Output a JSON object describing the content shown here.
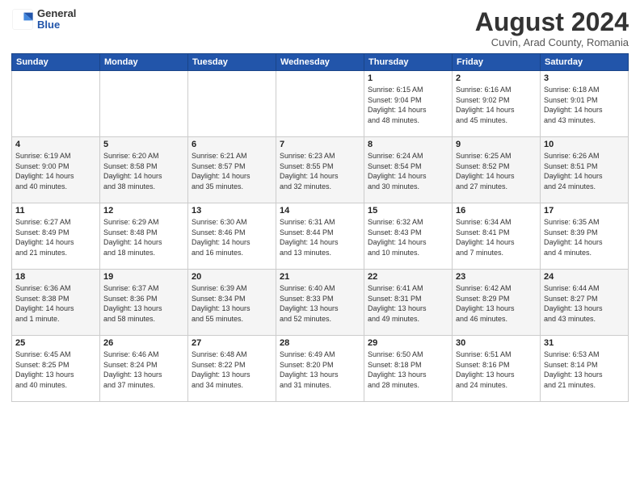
{
  "logo": {
    "general": "General",
    "blue": "Blue"
  },
  "header": {
    "title": "August 2024",
    "subtitle": "Cuvin, Arad County, Romania"
  },
  "days_of_week": [
    "Sunday",
    "Monday",
    "Tuesday",
    "Wednesday",
    "Thursday",
    "Friday",
    "Saturday"
  ],
  "weeks": [
    [
      {
        "day": "",
        "info": ""
      },
      {
        "day": "",
        "info": ""
      },
      {
        "day": "",
        "info": ""
      },
      {
        "day": "",
        "info": ""
      },
      {
        "day": "1",
        "info": "Sunrise: 6:15 AM\nSunset: 9:04 PM\nDaylight: 14 hours\nand 48 minutes."
      },
      {
        "day": "2",
        "info": "Sunrise: 6:16 AM\nSunset: 9:02 PM\nDaylight: 14 hours\nand 45 minutes."
      },
      {
        "day": "3",
        "info": "Sunrise: 6:18 AM\nSunset: 9:01 PM\nDaylight: 14 hours\nand 43 minutes."
      }
    ],
    [
      {
        "day": "4",
        "info": "Sunrise: 6:19 AM\nSunset: 9:00 PM\nDaylight: 14 hours\nand 40 minutes."
      },
      {
        "day": "5",
        "info": "Sunrise: 6:20 AM\nSunset: 8:58 PM\nDaylight: 14 hours\nand 38 minutes."
      },
      {
        "day": "6",
        "info": "Sunrise: 6:21 AM\nSunset: 8:57 PM\nDaylight: 14 hours\nand 35 minutes."
      },
      {
        "day": "7",
        "info": "Sunrise: 6:23 AM\nSunset: 8:55 PM\nDaylight: 14 hours\nand 32 minutes."
      },
      {
        "day": "8",
        "info": "Sunrise: 6:24 AM\nSunset: 8:54 PM\nDaylight: 14 hours\nand 30 minutes."
      },
      {
        "day": "9",
        "info": "Sunrise: 6:25 AM\nSunset: 8:52 PM\nDaylight: 14 hours\nand 27 minutes."
      },
      {
        "day": "10",
        "info": "Sunrise: 6:26 AM\nSunset: 8:51 PM\nDaylight: 14 hours\nand 24 minutes."
      }
    ],
    [
      {
        "day": "11",
        "info": "Sunrise: 6:27 AM\nSunset: 8:49 PM\nDaylight: 14 hours\nand 21 minutes."
      },
      {
        "day": "12",
        "info": "Sunrise: 6:29 AM\nSunset: 8:48 PM\nDaylight: 14 hours\nand 18 minutes."
      },
      {
        "day": "13",
        "info": "Sunrise: 6:30 AM\nSunset: 8:46 PM\nDaylight: 14 hours\nand 16 minutes."
      },
      {
        "day": "14",
        "info": "Sunrise: 6:31 AM\nSunset: 8:44 PM\nDaylight: 14 hours\nand 13 minutes."
      },
      {
        "day": "15",
        "info": "Sunrise: 6:32 AM\nSunset: 8:43 PM\nDaylight: 14 hours\nand 10 minutes."
      },
      {
        "day": "16",
        "info": "Sunrise: 6:34 AM\nSunset: 8:41 PM\nDaylight: 14 hours\nand 7 minutes."
      },
      {
        "day": "17",
        "info": "Sunrise: 6:35 AM\nSunset: 8:39 PM\nDaylight: 14 hours\nand 4 minutes."
      }
    ],
    [
      {
        "day": "18",
        "info": "Sunrise: 6:36 AM\nSunset: 8:38 PM\nDaylight: 14 hours\nand 1 minute."
      },
      {
        "day": "19",
        "info": "Sunrise: 6:37 AM\nSunset: 8:36 PM\nDaylight: 13 hours\nand 58 minutes."
      },
      {
        "day": "20",
        "info": "Sunrise: 6:39 AM\nSunset: 8:34 PM\nDaylight: 13 hours\nand 55 minutes."
      },
      {
        "day": "21",
        "info": "Sunrise: 6:40 AM\nSunset: 8:33 PM\nDaylight: 13 hours\nand 52 minutes."
      },
      {
        "day": "22",
        "info": "Sunrise: 6:41 AM\nSunset: 8:31 PM\nDaylight: 13 hours\nand 49 minutes."
      },
      {
        "day": "23",
        "info": "Sunrise: 6:42 AM\nSunset: 8:29 PM\nDaylight: 13 hours\nand 46 minutes."
      },
      {
        "day": "24",
        "info": "Sunrise: 6:44 AM\nSunset: 8:27 PM\nDaylight: 13 hours\nand 43 minutes."
      }
    ],
    [
      {
        "day": "25",
        "info": "Sunrise: 6:45 AM\nSunset: 8:25 PM\nDaylight: 13 hours\nand 40 minutes."
      },
      {
        "day": "26",
        "info": "Sunrise: 6:46 AM\nSunset: 8:24 PM\nDaylight: 13 hours\nand 37 minutes."
      },
      {
        "day": "27",
        "info": "Sunrise: 6:48 AM\nSunset: 8:22 PM\nDaylight: 13 hours\nand 34 minutes."
      },
      {
        "day": "28",
        "info": "Sunrise: 6:49 AM\nSunset: 8:20 PM\nDaylight: 13 hours\nand 31 minutes."
      },
      {
        "day": "29",
        "info": "Sunrise: 6:50 AM\nSunset: 8:18 PM\nDaylight: 13 hours\nand 28 minutes."
      },
      {
        "day": "30",
        "info": "Sunrise: 6:51 AM\nSunset: 8:16 PM\nDaylight: 13 hours\nand 24 minutes."
      },
      {
        "day": "31",
        "info": "Sunrise: 6:53 AM\nSunset: 8:14 PM\nDaylight: 13 hours\nand 21 minutes."
      }
    ]
  ]
}
